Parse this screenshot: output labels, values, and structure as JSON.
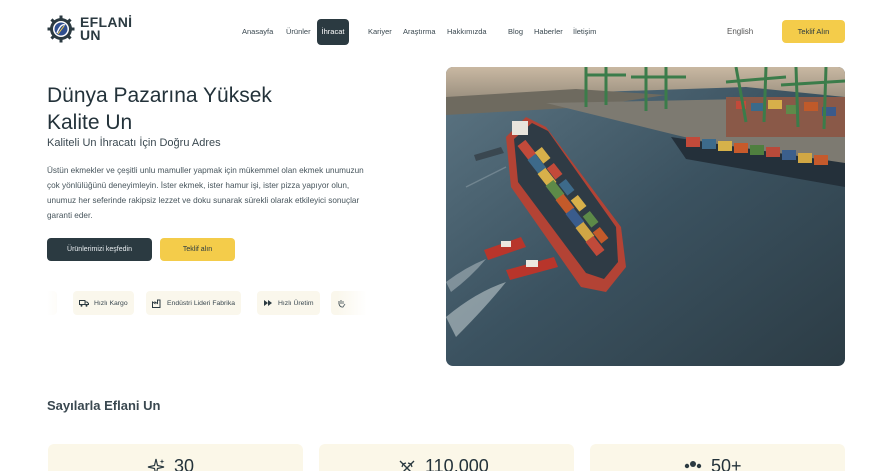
{
  "brand": {
    "line1": "EFLANİ",
    "line2": "UN"
  },
  "nav": {
    "items": [
      {
        "label": "Anasayfa"
      },
      {
        "label": "Ürünler"
      },
      {
        "label": "İhracat"
      },
      {
        "label": "Kariyer"
      },
      {
        "label": "Araştırma"
      },
      {
        "label": "Hakkımızda"
      },
      {
        "label": "Blog"
      },
      {
        "label": "Haberler"
      },
      {
        "label": "İletişim"
      }
    ],
    "active": "İhracat"
  },
  "header": {
    "language": "English",
    "quote_button": "Teklif Alın"
  },
  "hero": {
    "title": "Dünya Pazarına Yüksek Kalite Un",
    "subtitle": "Kaliteli Un İhracatı İçin Doğru Adres",
    "description": "Üstün ekmekler ve çeşitli unlu mamuller yapmak için mükemmel olan ekmek unumuzun çok yönlülüğünü deneyimleyin. İster ekmek, ister hamur işi, ister pizza yapıyor olun, unumuz her seferinde rakipsiz lezzet ve doku sunarak sürekli olarak etkileyici sonuçlar garanti eder.",
    "primary_button": "Ürünlerimizi keşfedin",
    "secondary_button": "Teklif alın",
    "image_alt": "container-ship-port"
  },
  "features": [
    {
      "label": "Hızlı Kargo",
      "icon": "truck-icon"
    },
    {
      "label": "Endüstri Lideri Fabrika",
      "icon": "factory-icon"
    },
    {
      "label": "Hızlı Üretim",
      "icon": "fast-forward-icon"
    }
  ],
  "stats": {
    "title": "Sayılarla Eflani Un",
    "items": [
      {
        "value": "30",
        "icon": "sparkle-icon"
      },
      {
        "value": "110.000",
        "icon": "wheat-icon"
      },
      {
        "value": "50+",
        "icon": "people-icon"
      }
    ]
  },
  "colors": {
    "primary": "#2b3a41",
    "accent": "#f4cc4a",
    "card": "#fbf7e8"
  }
}
